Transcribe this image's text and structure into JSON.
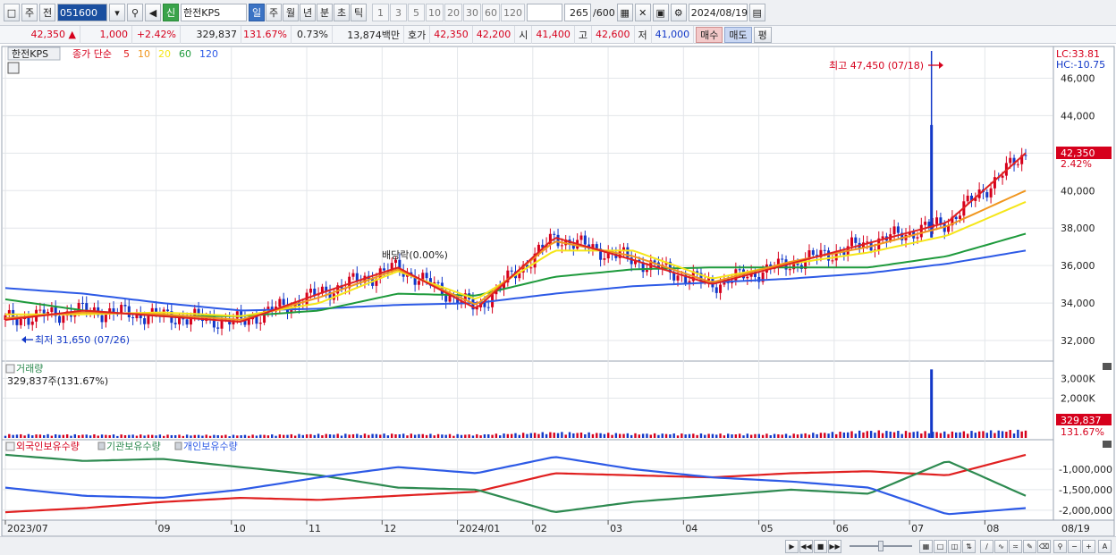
{
  "toolbar": {
    "period_select": "주",
    "prev_label": "전",
    "stock_code": "051600",
    "badge": "신",
    "stock_name": "한전KPS",
    "period_buttons": [
      "일",
      "주",
      "월",
      "년",
      "분",
      "초",
      "틱"
    ],
    "active_period": "일",
    "minute_options": [
      "1",
      "3",
      "5",
      "10",
      "20",
      "30",
      "60",
      "120"
    ],
    "count": "265",
    "count_max": "/600",
    "date": "2024/08/19"
  },
  "quote": {
    "price": "42,350",
    "direction": "▲",
    "change": "1,000",
    "change_rate": "+2.42%",
    "volume": "329,837",
    "volume_rate": "131.67%",
    "turnover": "0.73%",
    "amount": "13,874백만",
    "bid_label": "호가",
    "ask": "42,350",
    "bid": "42,200",
    "open_label": "시",
    "open": "41,400",
    "high_label": "고",
    "high": "42,600",
    "low_label": "저",
    "low": "41,000",
    "buy_label": "매수",
    "sell_label": "매도",
    "avg_label": "평"
  },
  "price_panel": {
    "name_tag": "한전KPS",
    "legend_prefix": "종가 단순",
    "ma_periods": [
      "5",
      "10",
      "20",
      "60",
      "120"
    ],
    "lc_label": "LC:33.81",
    "hc_label": "HC:-10.75",
    "max_label": "최고 47,450 (07/18)",
    "min_label": "최저 31,650 (07/26)",
    "dividend_label": "배당락(0.00%)",
    "current_price_tag": "42,350",
    "current_rate_tag": "2.42%"
  },
  "volume_panel": {
    "title": "거래량",
    "value_label": "329,837주(131.67%)",
    "current_tag": "329,837",
    "current_rate_tag": "131.67%"
  },
  "holdings_panel": {
    "legend": [
      "외국인보유수량",
      "기관보유수량",
      "개인보유수량"
    ]
  },
  "x_axis": {
    "labels": [
      "2023/07",
      "09",
      "10",
      "11",
      "12",
      "2024/01",
      "02",
      "03",
      "04",
      "05",
      "06",
      "07",
      "08"
    ],
    "last_label": "08/19"
  },
  "colors": {
    "up": "#d6001c",
    "down": "#1238c8",
    "ma5": "#e02020",
    "ma10": "#f0961e",
    "ma20": "#f5e619",
    "ma60": "#1e9a3c",
    "ma120": "#2d5ae6",
    "foreign": "#e02020",
    "institution": "#2d8a50",
    "individual": "#2d5ae6"
  },
  "chart_data": [
    {
      "type": "line",
      "title": "",
      "xlabel": "",
      "ylabel": "",
      "x": [
        "2023/07",
        "09",
        "10",
        "11",
        "12",
        "2024/01",
        "02",
        "03",
        "04",
        "05",
        "06",
        "07",
        "08",
        "08/19"
      ],
      "series": [
        {
          "name": "5",
          "values": [
            33100,
            33600,
            33300,
            33000,
            34500,
            35900,
            33700,
            37500,
            36300,
            35000,
            36100,
            37200,
            38300,
            42000
          ]
        },
        {
          "name": "10",
          "values": [
            33200,
            33500,
            33400,
            33100,
            34300,
            35800,
            33900,
            37300,
            36500,
            35100,
            36200,
            37000,
            38100,
            40000
          ]
        },
        {
          "name": "20",
          "values": [
            33400,
            33400,
            33500,
            33300,
            34000,
            35700,
            34200,
            36800,
            36800,
            35300,
            36100,
            36700,
            37600,
            39400
          ]
        },
        {
          "name": "60",
          "values": [
            34200,
            33600,
            33300,
            33300,
            33600,
            34500,
            34400,
            35400,
            35800,
            35900,
            35900,
            35900,
            36500,
            37700
          ]
        },
        {
          "name": "120",
          "values": [
            34800,
            34500,
            34000,
            33600,
            33700,
            33900,
            34000,
            34500,
            34900,
            35100,
            35300,
            35600,
            36100,
            36800
          ]
        }
      ],
      "ylim": [
        31000,
        47500
      ],
      "y_ticks": [
        "32,000",
        "34,000",
        "36,000",
        "38,000",
        "40,000",
        "42,000",
        "44,000",
        "46,000"
      ],
      "annotations": {
        "max": 47450,
        "min": 31650,
        "current": 42350
      }
    },
    {
      "type": "bar",
      "title": "거래량",
      "x": [
        "2023/07",
        "09",
        "10",
        "11",
        "12",
        "2024/01",
        "02",
        "03",
        "04",
        "05",
        "06",
        "07",
        "08",
        "08/19"
      ],
      "values": [
        150000,
        140000,
        130000,
        120000,
        160000,
        170000,
        140000,
        240000,
        180000,
        170000,
        160000,
        300000,
        250000,
        329837
      ],
      "peak": 3450000,
      "ylim": [
        0,
        3600000
      ],
      "y_ticks": [
        "2,000K",
        "3,000K"
      ]
    },
    {
      "type": "line",
      "title": "",
      "x": [
        "2023/07",
        "09",
        "10",
        "11",
        "12",
        "2024/01",
        "02",
        "03",
        "04",
        "05",
        "06",
        "07",
        "08",
        "08/19"
      ],
      "series": [
        {
          "name": "외국인보유수량",
          "values": [
            -2050000,
            -1950000,
            -1800000,
            -1700000,
            -1750000,
            -1650000,
            -1550000,
            -1100000,
            -1150000,
            -1200000,
            -1100000,
            -1050000,
            -1150000,
            -650000
          ]
        },
        {
          "name": "기관보유수량",
          "values": [
            -650000,
            -800000,
            -750000,
            -950000,
            -1150000,
            -1450000,
            -1500000,
            -2050000,
            -1800000,
            -1650000,
            -1500000,
            -1600000,
            -800000,
            -1650000
          ]
        },
        {
          "name": "개인보유수량",
          "values": [
            -1450000,
            -1650000,
            -1700000,
            -1500000,
            -1200000,
            -950000,
            -1100000,
            -700000,
            -1000000,
            -1200000,
            -1300000,
            -1450000,
            -2100000,
            -1950000
          ]
        }
      ],
      "ylim": [
        -2200000,
        -500000
      ],
      "y_ticks": [
        "-1,000,000",
        "-1,500,000",
        "-2,000,000"
      ]
    }
  ]
}
